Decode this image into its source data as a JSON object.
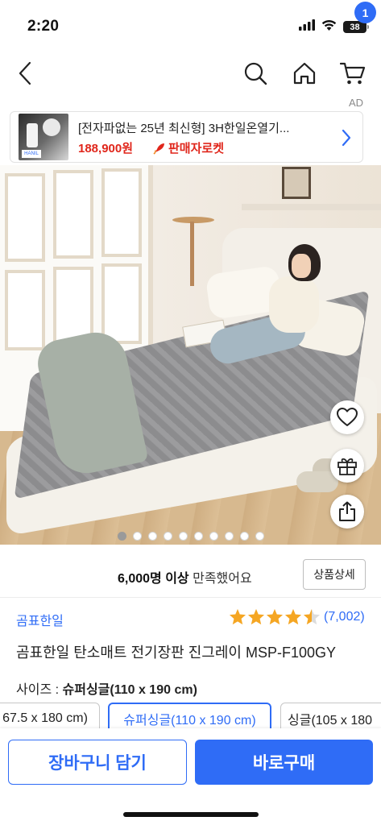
{
  "status_bar": {
    "time": "2:20",
    "battery": "38"
  },
  "nav": {
    "cart_count": "1"
  },
  "ad": {
    "label": "AD",
    "title": "[전자파없는 25년 최신형] 3H한일온열기...",
    "price": "188,900원",
    "delivery_badge": "판매자로켓",
    "thumb_brand": "HANIL"
  },
  "gallery": {
    "total_images": 10,
    "active_index": 0
  },
  "satisfaction": {
    "count": "6,000명 이상",
    "suffix": "만족했어요",
    "detail_button": "상품상세"
  },
  "product": {
    "brand": "곰표한일",
    "rating": 4.5,
    "review_count": "(7,002)",
    "title": "곰표한일 탄소매트 전기장판 진그레이 MSP-F100GY",
    "size_label": "사이즈 : ",
    "selected_size": "슈퍼싱글(110 x 190 cm)",
    "size_options": [
      {
        "label": "67.5 x 180 cm)",
        "selected": false
      },
      {
        "label": "슈퍼싱글(110 x 190 cm)",
        "selected": true
      },
      {
        "label": "싱글(105 x 180",
        "selected": false
      }
    ]
  },
  "actions": {
    "add_to_cart": "장바구니 담기",
    "buy_now": "바로구매"
  },
  "colors": {
    "accent": "#2f6cf6",
    "price_red": "#e0261b",
    "star": "#f5a623"
  }
}
